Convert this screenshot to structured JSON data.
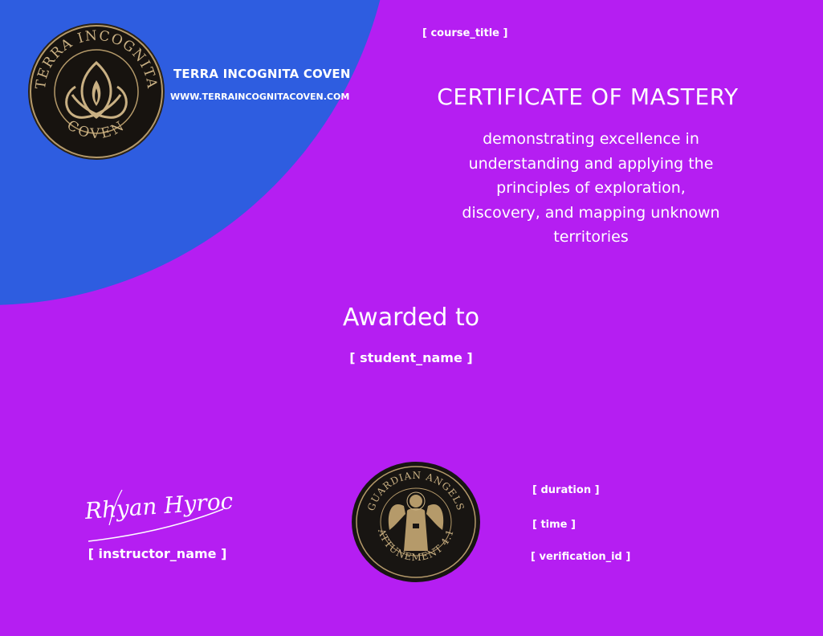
{
  "organization": {
    "name": "TERRA INCOGNITA COVEN",
    "url": "WWW.TERRAINCOGNITACOVEN.COM",
    "logo_ring_text": "TERRA INCOGNITA COVEN"
  },
  "certificate": {
    "course_title": "[ course_title ]",
    "heading": "CERTIFICATE OF MASTERY",
    "description_lines": [
      "demonstrating excellence in",
      "understanding and applying the",
      "principles of exploration,",
      "discovery, and mapping unknown",
      "territories"
    ],
    "awarded_label": "Awarded to",
    "student_placeholder": "[ student_name ]"
  },
  "signature": {
    "signed_text": "Rhyan Hyroc",
    "instructor_placeholder": "[ instructor_name ]"
  },
  "seal": {
    "ring_top": "GUARDIAN ANGELS",
    "ring_bottom": "ATTUNEMENT 4.1"
  },
  "meta": {
    "duration": "[ duration ]",
    "time": "[ time ]",
    "verification_id": "[ verification_id ]"
  },
  "colors": {
    "background": "#b51ef2",
    "arc": "#2e5de0",
    "seal_dark": "#181512",
    "seal_gold": "#b59a6a",
    "text": "#ffffff"
  }
}
